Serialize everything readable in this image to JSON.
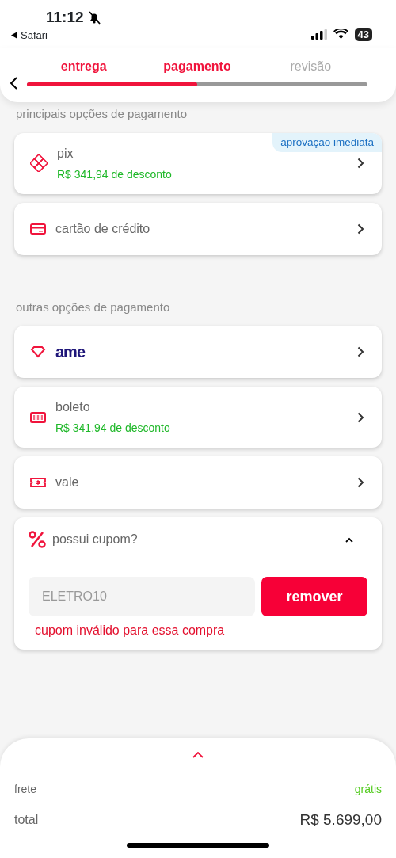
{
  "status_bar": {
    "time": "11:12",
    "silent": true,
    "back_app": "Safari",
    "battery": "43"
  },
  "steps": [
    {
      "label": "entrega",
      "done": true
    },
    {
      "label": "pagamento",
      "done": true
    },
    {
      "label": "revisão",
      "done": false
    }
  ],
  "progress": {
    "level": 0.5
  },
  "sections": [
    {
      "title": "principais opções de pagamento",
      "options": [
        {
          "kind": "pix",
          "label": "pix",
          "discount": "R$ 341,94 de desconto",
          "badge": "aprovação imediata"
        },
        {
          "kind": "card",
          "label": "cartão de crédito"
        }
      ]
    },
    {
      "title": "outras opções de pagamento",
      "options": [
        {
          "kind": "ame",
          "label": "ame"
        },
        {
          "kind": "boleto",
          "label": "boleto",
          "discount": "R$ 341,94 de desconto"
        },
        {
          "kind": "vale",
          "label": "vale"
        }
      ]
    }
  ],
  "coupon": {
    "title": "possui cupom?",
    "expanded": true,
    "value": "ELETRO10",
    "disabled": true,
    "button": "remover",
    "error": "cupom inválido para essa compra"
  },
  "summary": {
    "rows": [
      {
        "kind": "shipping",
        "label": "frete",
        "value": "grátis"
      },
      {
        "kind": "total",
        "label": "total",
        "value": "R$ 5.699,00"
      }
    ]
  }
}
